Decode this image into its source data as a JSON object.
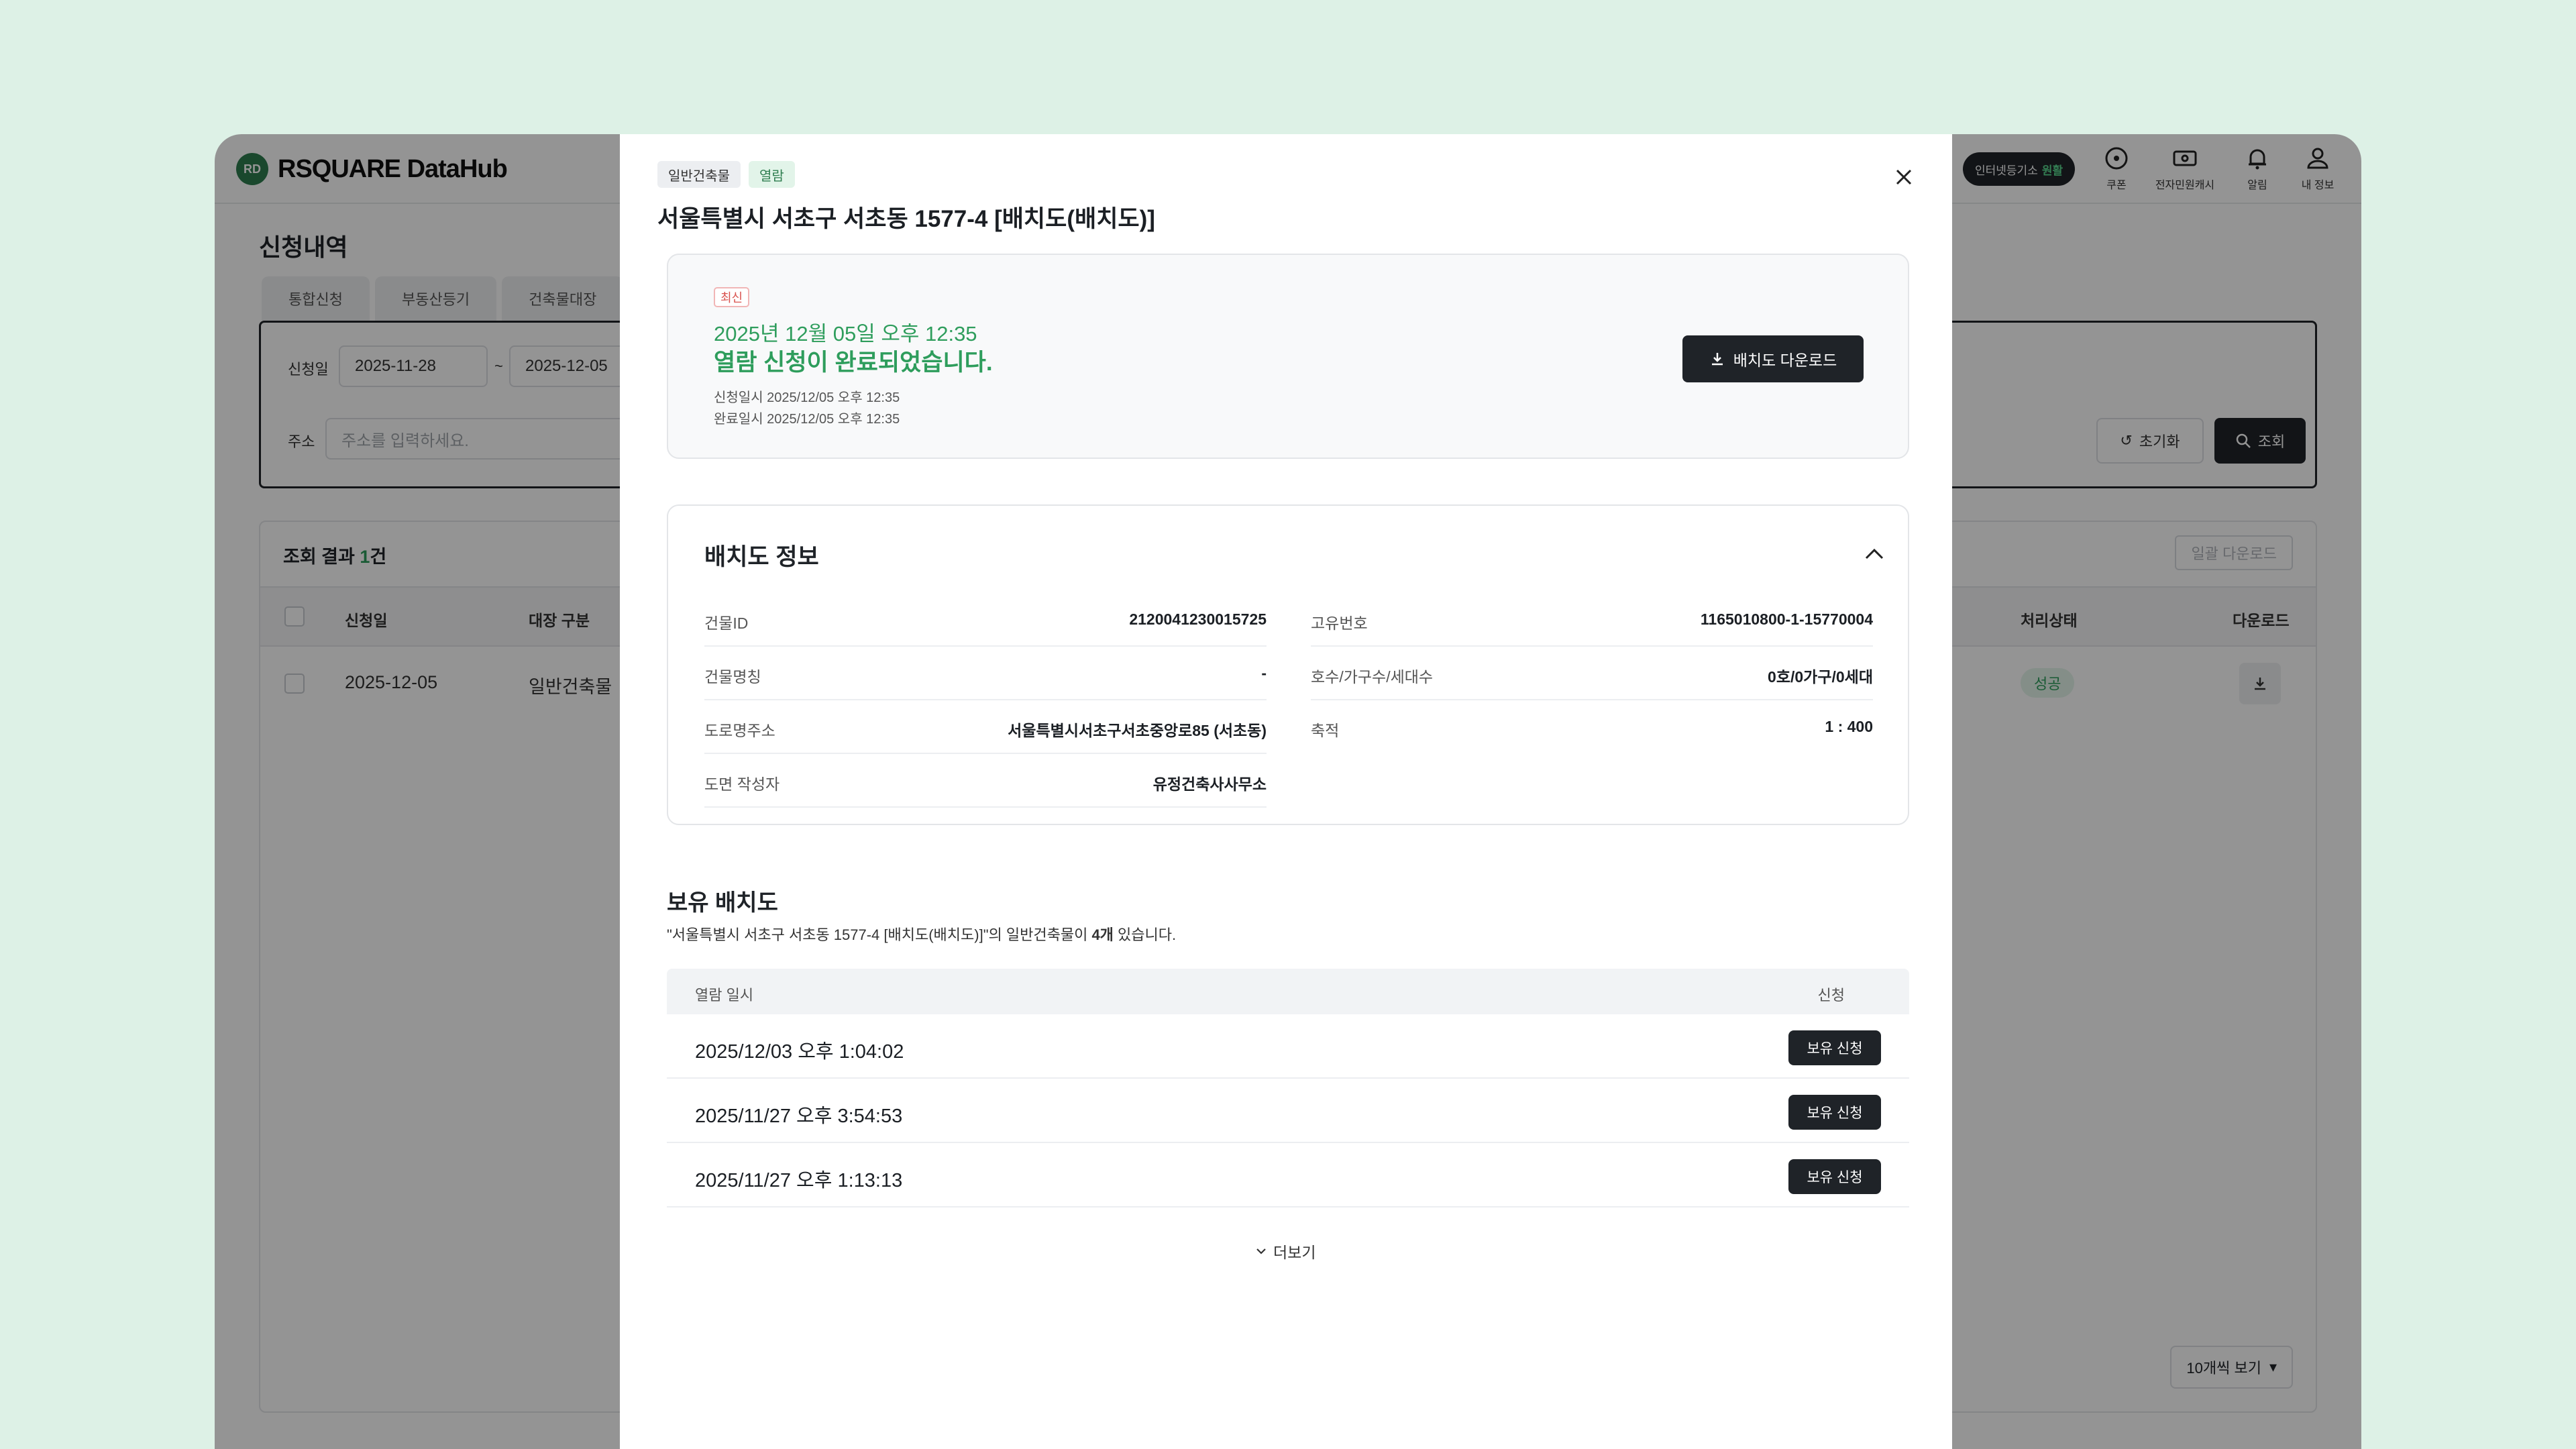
{
  "app": {
    "logo_mark": "RD",
    "logo_text": "RSQUARE DataHub",
    "status_pill_label": "인터넷등기소",
    "status_pill_value": "원활",
    "header_icons": [
      {
        "label": "쿠폰",
        "icon": "coupon-icon"
      },
      {
        "label": "전자민원캐시",
        "icon": "cash-icon"
      },
      {
        "label": "알림",
        "icon": "bell-icon"
      },
      {
        "label": "내 정보",
        "icon": "user-icon"
      }
    ],
    "page_title": "신청내역",
    "tabs": [
      "통합신청",
      "부동산등기",
      "건축물대장"
    ],
    "filter": {
      "date_label": "신청일",
      "date_from": "2025-11-28",
      "date_sep": "~",
      "date_to": "2025-12-05",
      "address_label": "주소",
      "address_placeholder": "주소를 입력하세요.",
      "reset_label": "초기화",
      "search_label": "조회"
    },
    "results": {
      "title_prefix": "조회 결과",
      "count": "1",
      "title_suffix": "건",
      "bulk_download_label": "일괄 다운로드",
      "columns": [
        "신청일",
        "대장 구분",
        "처리상태",
        "다운로드"
      ],
      "rows": [
        {
          "date": "2025-12-05",
          "type": "일반건축물",
          "status": "성공"
        }
      ],
      "page_size_label": "10개씩 보기"
    }
  },
  "modal": {
    "tags": [
      "일반건축물",
      "열람"
    ],
    "title": "서울특별시 서초구 서초동 1577-4 [배치도(배치도)]",
    "status": {
      "latest_label": "최신",
      "date": "2025년 12월 05일 오후 12:35",
      "message": "열람 신청이 완료되었습니다.",
      "requested_at": "신청일시 2025/12/05 오후 12:35",
      "completed_at": "완료일시 2025/12/05 오후 12:35",
      "download_label": "배치도 다운로드"
    },
    "info": {
      "heading": "배치도 정보",
      "left": [
        {
          "key": "건물ID",
          "value": "2120041230015725"
        },
        {
          "key": "건물명칭",
          "value": "-"
        },
        {
          "key": "도로명주소",
          "value": "서울특별시서초구서초중앙로85 (서초동)"
        },
        {
          "key": "도면 작성자",
          "value": "유정건축사사무소"
        }
      ],
      "right": [
        {
          "key": "고유번호",
          "value": "1165010800-1-15770004"
        },
        {
          "key": "호수/가구수/세대수",
          "value": "0호/0가구/0세대"
        },
        {
          "key": "축적",
          "value": "1 : 400"
        }
      ]
    },
    "owned": {
      "heading": "보유 배치도",
      "desc_prefix": "\"서울특별시 서초구 서초동 1577-4 [배치도(배치도)]\"의 일반건축물이 ",
      "desc_count": "4개",
      "desc_suffix": " 있습니다.",
      "col_date": "열람 일시",
      "col_apply": "신청",
      "rows": [
        {
          "date": "2025/12/03 오후 1:04:02",
          "button": "보유 신청"
        },
        {
          "date": "2025/11/27 오후 3:54:53",
          "button": "보유 신청"
        },
        {
          "date": "2025/11/27 오후 1:13:13",
          "button": "보유 신청"
        }
      ],
      "more_label": "더보기"
    }
  },
  "colors": {
    "accent_green": "#2e9d5c",
    "dark_button": "#1f2328",
    "page_background": "#ddf1e6",
    "latest_red": "#d9534f"
  }
}
